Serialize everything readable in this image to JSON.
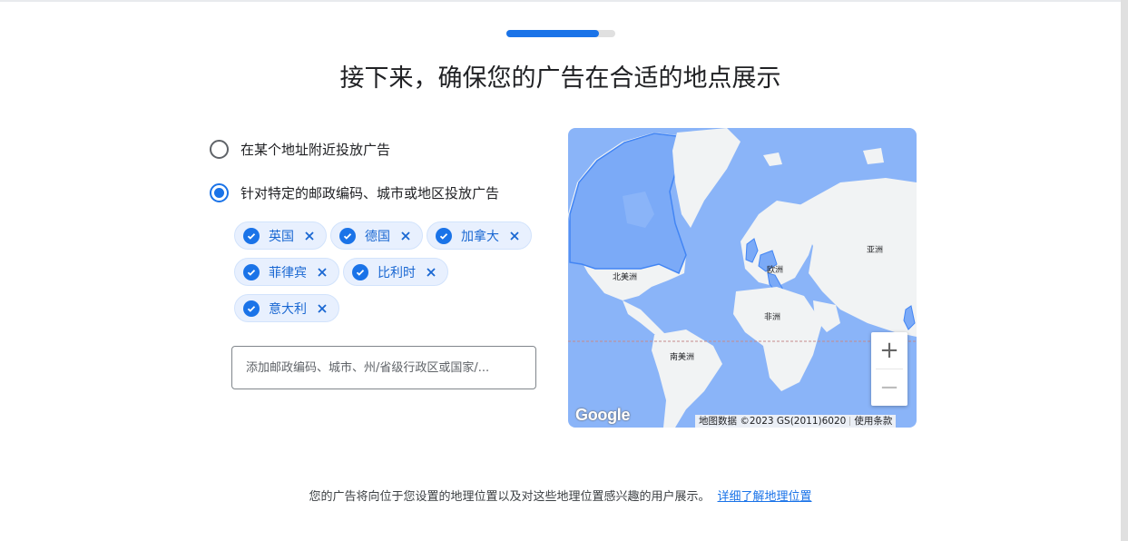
{
  "progress": {
    "value": 0.85
  },
  "page": {
    "title": "接下来，确保您的广告在合适的地点展示"
  },
  "options": [
    {
      "label": "在某个地址附近投放广告",
      "selected": false
    },
    {
      "label": "针对特定的邮政编码、城市或地区投放广告",
      "selected": true
    }
  ],
  "chips": [
    "英国",
    "德国",
    "加拿大",
    "菲律宾",
    "比利时",
    "意大利"
  ],
  "location_input": {
    "placeholder": "添加邮政编码、城市、州/省级行政区或国家/...",
    "value": ""
  },
  "map": {
    "labels": {
      "north_america": "北美洲",
      "europe": "欧洲",
      "asia": "亚洲",
      "africa": "非洲",
      "south_america": "南美洲"
    },
    "zoom_in": "+",
    "zoom_out": "−",
    "logo": "Google",
    "attribution": "地图数据 ©2023 GS(2011)6020",
    "terms": "使用条款",
    "colors": {
      "water": "#8ab4f8",
      "land": "#f1f3f4",
      "selected": "#7baaf7",
      "selected_border": "#4285f4"
    }
  },
  "footer": {
    "text": "您的广告将向位于您设置的地理位置以及对这些地理位置感兴趣的用户展示。",
    "link": "详细了解地理位置"
  },
  "accent_color": "#1a73e8"
}
